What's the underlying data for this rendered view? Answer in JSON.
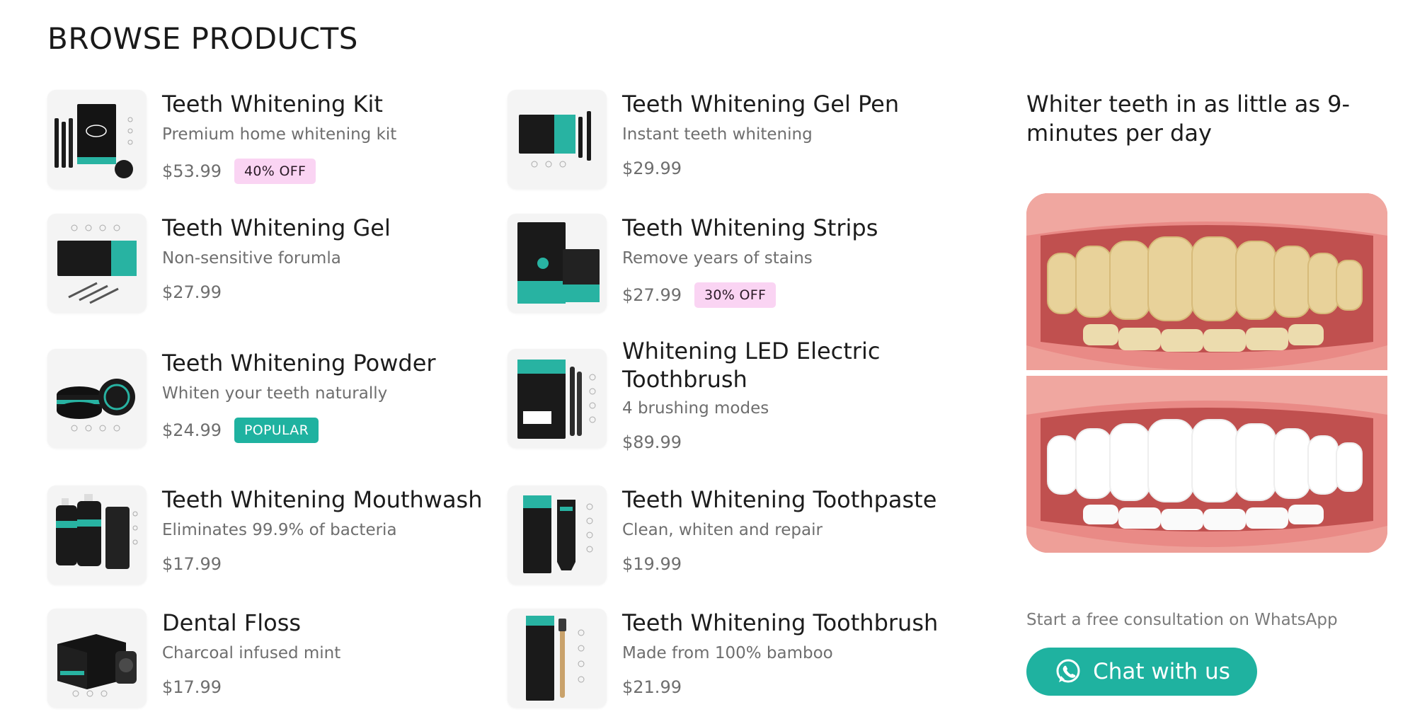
{
  "page": {
    "title": "BROWSE PRODUCTS"
  },
  "products": [
    {
      "name": "Teeth Whitening Kit",
      "desc": "Premium home whitening kit",
      "price": "$53.99",
      "badge": "40% OFF"
    },
    {
      "name": "Teeth Whitening Gel Pen",
      "desc": "Instant teeth whitening",
      "price": "$29.99"
    },
    {
      "name": "Teeth Whitening Gel",
      "desc": "Non-sensitive forumla",
      "price": "$27.99"
    },
    {
      "name": "Teeth Whitening Strips",
      "desc": "Remove years of stains",
      "price": "$27.99",
      "badge": "30% OFF"
    },
    {
      "name": "Teeth Whitening Powder",
      "desc": "Whiten your teeth naturally",
      "price": "$24.99",
      "badge": "POPULAR"
    },
    {
      "name": "Whitening LED Electric Toothbrush",
      "desc": "4 brushing modes",
      "price": "$89.99"
    },
    {
      "name": "Teeth Whitening Mouthwash",
      "desc": "Eliminates 99.9% of bacteria",
      "price": "$17.99"
    },
    {
      "name": "Teeth Whitening Toothpaste",
      "desc": "Clean, whiten and repair",
      "price": "$19.99"
    },
    {
      "name": "Dental Floss",
      "desc": "Charcoal infused mint",
      "price": "$17.99"
    },
    {
      "name": "Teeth Whitening Toothbrush",
      "desc": "Made from 100% bamboo",
      "price": "$21.99"
    }
  ],
  "sidebar": {
    "heading": "Whiter teeth in as little as 9-minutes per day",
    "consult_text": "Start a free consultation on WhatsApp",
    "chat_label": "Chat with us",
    "chat_icon": "whatsapp-icon"
  },
  "colors": {
    "accent": "#1fb2a0",
    "badge_pink": "#fad4f3",
    "text_dark": "#1c1c1c",
    "text_muted": "#6e6e6e"
  }
}
